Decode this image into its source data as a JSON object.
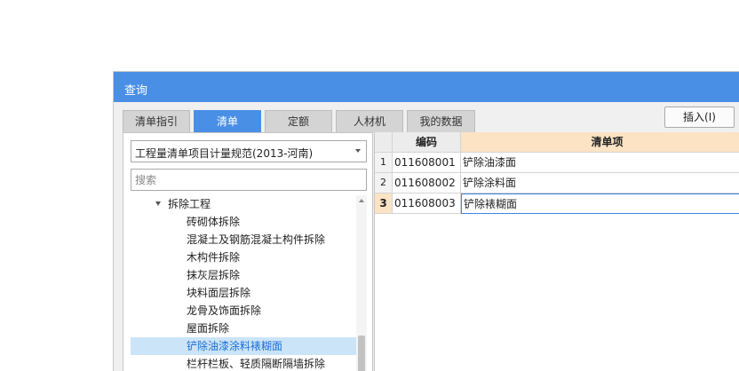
{
  "dialog": {
    "title": "查询"
  },
  "tabs": [
    {
      "label": "清单指引",
      "active": false
    },
    {
      "label": "清单",
      "active": true
    },
    {
      "label": "定额",
      "active": false
    },
    {
      "label": "人材机",
      "active": false
    },
    {
      "label": "我的数据",
      "active": false
    }
  ],
  "insert_button": {
    "label": "插入(I)"
  },
  "left": {
    "norm_select": {
      "value": "工程量清单项目计量规范(2013-河南)"
    },
    "search": {
      "placeholder": "搜索",
      "value": ""
    },
    "tree": [
      {
        "label": "拆除工程",
        "expanded": true,
        "level": 1
      },
      {
        "label": "砖砌体拆除",
        "level": 2
      },
      {
        "label": "混凝土及钢筋混凝土构件拆除",
        "level": 2
      },
      {
        "label": "木构件拆除",
        "level": 2
      },
      {
        "label": "抹灰层拆除",
        "level": 2
      },
      {
        "label": "块料面层拆除",
        "level": 2
      },
      {
        "label": "龙骨及饰面拆除",
        "level": 2
      },
      {
        "label": "屋面拆除",
        "level": 2
      },
      {
        "label": "铲除油漆涂料裱糊面",
        "level": 2,
        "selected": true
      },
      {
        "label": "栏杆栏板、轻质隔断隔墙拆除",
        "level": 2
      }
    ]
  },
  "grid": {
    "columns": [
      "编码",
      "清单项"
    ],
    "rows": [
      {
        "num": "1",
        "code": "011608001",
        "name": "铲除油漆面"
      },
      {
        "num": "2",
        "code": "011608002",
        "name": "铲除涂料面"
      },
      {
        "num": "3",
        "code": "011608003",
        "name": "铲除裱糊面",
        "current": true
      }
    ]
  },
  "colors": {
    "accent": "#4a8fe6",
    "header_accent": "#fbe3c3",
    "tree_selected": "#cce4f7"
  }
}
